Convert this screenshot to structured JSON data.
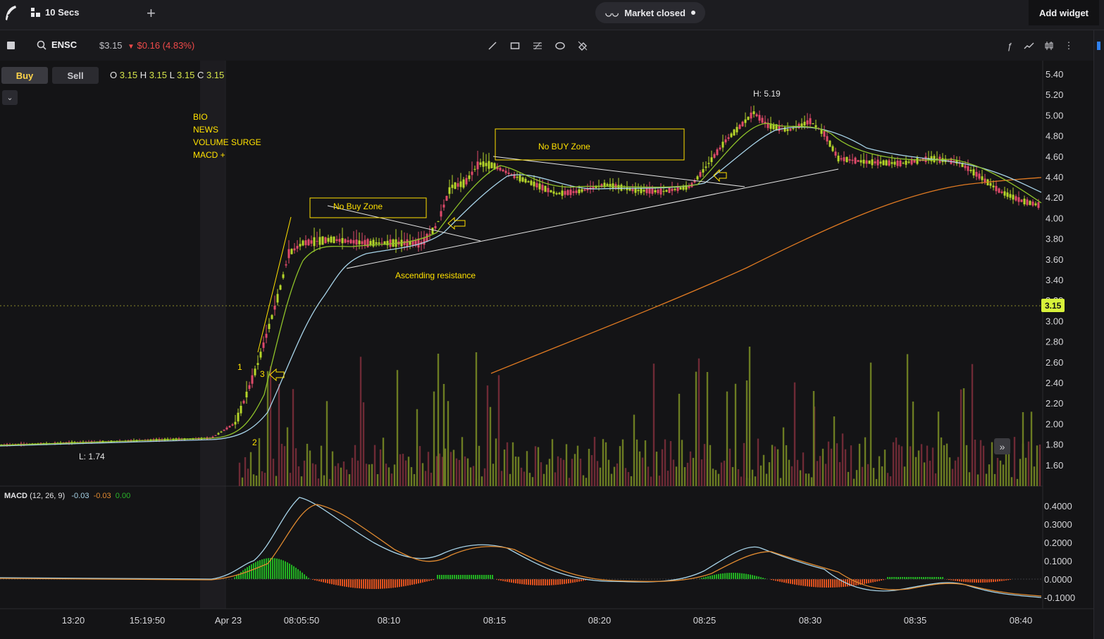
{
  "topbar": {
    "timeframe": "10 Secs",
    "market_status": "Market closed",
    "add_widget": "Add widget"
  },
  "toolbar": {
    "symbol": "ENSC",
    "price": "$3.15",
    "change": "$0.16 (4.83%)",
    "change_arrow": "▼",
    "drawing_tools": [
      "line-icon",
      "rectangle-icon",
      "fib-icon",
      "ellipse-icon",
      "eraser-icon"
    ],
    "right_tools": [
      "function-icon",
      "indicator-icon",
      "chart-type-icon",
      "more-icon"
    ]
  },
  "order": {
    "buy": "Buy",
    "sell": "Sell"
  },
  "ohlc": {
    "o_label": "O",
    "o": "3.15",
    "h_label": "H",
    "h": "3.15",
    "l_label": "L",
    "l": "3.15",
    "c_label": "C",
    "c": "3.15"
  },
  "chart_data": {
    "type": "candlestick",
    "price_axis": [
      "5.40",
      "5.20",
      "5.00",
      "4.80",
      "4.60",
      "4.40",
      "4.20",
      "4.00",
      "3.80",
      "3.60",
      "3.40",
      "3.20",
      "3.00",
      "2.80",
      "2.60",
      "2.40",
      "2.20",
      "2.00",
      "1.80",
      "1.60"
    ],
    "current_price_tag": "3.15",
    "high_label": "H: 5.19",
    "low_label": "L: 1.74",
    "time_axis": [
      "13:20",
      "15:19:50",
      "Apr 23",
      "08:05:50",
      "08:10",
      "08:15",
      "08:20",
      "08:25",
      "08:30",
      "08:35",
      "08:40"
    ],
    "annotations": {
      "catalysts": [
        "BIO",
        "NEWS",
        "VOLUME SURGE",
        "MACD +"
      ],
      "no_buy_zone_1": "No Buy Zone",
      "no_buy_zone_2": "No BUY Zone",
      "ascending": "Ascending resistance",
      "wave_labels": [
        "1",
        "2",
        "3"
      ]
    },
    "colors": {
      "up": "#b6d629",
      "down": "#e04a6a",
      "ema_fast": "#9ccc2a",
      "ema_slow": "#a7d3e8",
      "sma_long": "#e07a22",
      "annotation": "#ffe100",
      "price_tag": "#d8f23a"
    },
    "macd": {
      "label": "MACD",
      "params": "(12, 26, 9)",
      "macd": "-0.03",
      "signal": "-0.03",
      "hist": "0.00",
      "axis": [
        "0.4000",
        "0.3000",
        "0.2000",
        "0.1000",
        "0.0000",
        "-0.1000"
      ]
    }
  }
}
